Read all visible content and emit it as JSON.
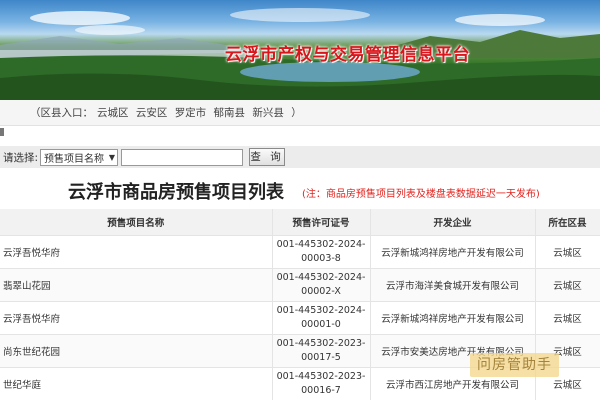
{
  "banner": {
    "title": "云浮市产权与交易管理信息平台"
  },
  "district_bar": {
    "prefix": "（区县入口：",
    "districts": [
      "云城区",
      "云安区",
      "罗定市",
      "郁南县",
      "新兴县"
    ],
    "suffix": "）"
  },
  "search": {
    "label": "请选择:",
    "selected_option": "预售项目名称",
    "input_value": "",
    "button_label": "查 询"
  },
  "list": {
    "title": "云浮市商品房预售项目列表",
    "note": "(注：商品房预售项目列表及楼盘表数据延迟一天发布)",
    "columns": [
      "预售项目名称",
      "预售许可证号",
      "开发企业",
      "所在区县"
    ],
    "rows": [
      {
        "name": "云浮吾悦华府",
        "permit_line1": "001-445302-2024-",
        "permit_line2": "00003-8",
        "developer": "云浮新城鸿祥房地产开发有限公司",
        "district": "云城区"
      },
      {
        "name": "翡翠山花园",
        "permit_line1": "001-445302-2024-",
        "permit_line2": "00002-X",
        "developer": "云浮市海洋美食城开发有限公司",
        "district": "云城区"
      },
      {
        "name": "云浮吾悦华府",
        "permit_line1": "001-445302-2024-",
        "permit_line2": "00001-0",
        "developer": "云浮新城鸿祥房地产开发有限公司",
        "district": "云城区"
      },
      {
        "name": "尚东世纪花园",
        "permit_line1": "001-445302-2023-",
        "permit_line2": "00017-5",
        "developer": "云浮市安美达房地产开发有限公司",
        "district": "云城区"
      },
      {
        "name": "世纪华庭",
        "permit_line1": "001-445302-2023-",
        "permit_line2": "00016-7",
        "developer": "云浮市西江房地产开发有限公司",
        "district": "云城区"
      }
    ]
  },
  "watermark": "问房管助手",
  "colors": {
    "title_red": "#d8161b",
    "note_red": "#e0231e",
    "header_bg": "#f2f2f2"
  }
}
